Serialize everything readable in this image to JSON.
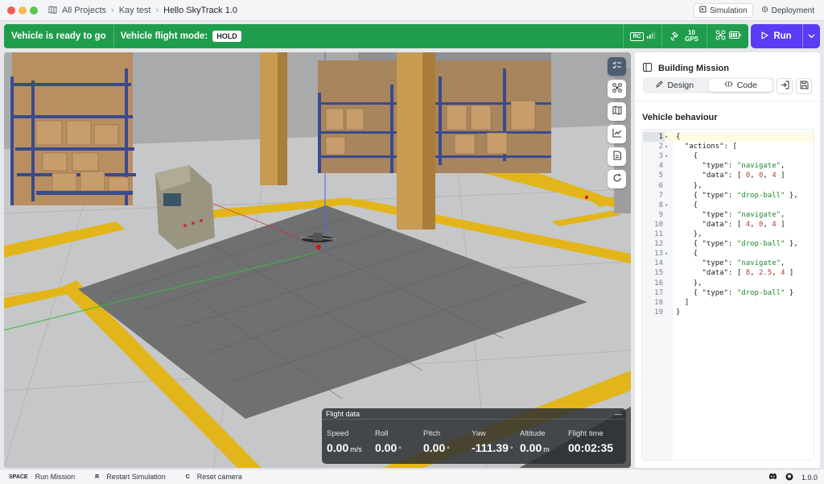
{
  "window": {
    "breadcrumbs": [
      "All Projects",
      "Kay test",
      "Hello SkyTrack 1.0"
    ],
    "tabs": [
      {
        "label": "Simulation",
        "active": true
      },
      {
        "label": "Deployment",
        "active": false
      }
    ]
  },
  "status": {
    "ready_text": "Vehicle is ready to go",
    "mode_label": "Vehicle flight mode:",
    "mode_value": "HOLD",
    "rc_label": "RC",
    "gps_count": "10",
    "gps_label": "GPS",
    "color": "#1f9d4c"
  },
  "run": {
    "label": "Run",
    "color": "#5b3cf5"
  },
  "flight_data": {
    "title": "Flight data",
    "items": [
      {
        "label": "Speed",
        "value": "0.00",
        "unit": "m/s"
      },
      {
        "label": "Roll",
        "value": "0.00",
        "unit": "°"
      },
      {
        "label": "Pitch",
        "value": "0.00",
        "unit": "°"
      },
      {
        "label": "Yaw",
        "value": "-111.39",
        "unit": "°"
      },
      {
        "label": "Altitude",
        "value": "0.00",
        "unit": "m"
      },
      {
        "label": "Flight time",
        "value": "00:02:35",
        "unit": ""
      }
    ]
  },
  "viewport_tools": [
    "checklist-icon",
    "drone-icon",
    "map-icon",
    "chart-icon",
    "document-icon",
    "refresh-icon"
  ],
  "panel": {
    "title": "Building Mission",
    "tabs": [
      {
        "label": "Design",
        "active": false
      },
      {
        "label": "Code",
        "active": true
      }
    ],
    "section_label": "Vehicle behaviour",
    "code_lines": [
      "{",
      "  \"actions\": [",
      "    {",
      "      \"type\": \"navigate\",",
      "      \"data\": [ 0, 0, 4 ]",
      "    },",
      "    { \"type\": \"drop-ball\" },",
      "    {",
      "      \"type\": \"navigate\",",
      "      \"data\": [ 4, 0, 4 ]",
      "    },",
      "    { \"type\": \"drop-ball\" },",
      "    {",
      "      \"type\": \"navigate\",",
      "      \"data\": [ 8, 2.5, 4 ]",
      "    },",
      "    { \"type\": \"drop-ball\" }",
      "  ]",
      "}"
    ],
    "fold_lines": [
      1,
      2,
      3,
      8,
      13
    ]
  },
  "shortcuts": [
    {
      "key": "SPACE",
      "label": "Run Mission"
    },
    {
      "key": "R",
      "label": "Restart Simulation"
    },
    {
      "key": "C",
      "label": "Reset camera"
    }
  ],
  "version": "1.0.0"
}
